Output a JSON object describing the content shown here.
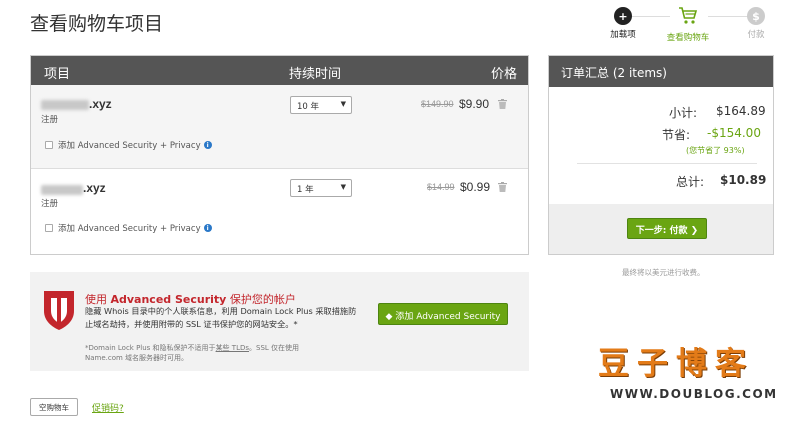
{
  "page": {
    "title": "查看购物车项目"
  },
  "steps": [
    {
      "label": "加载项",
      "glyph": "+"
    },
    {
      "label": "查看购物车"
    },
    {
      "label": "付款",
      "glyph": "$"
    }
  ],
  "cart": {
    "headers": {
      "item": "项目",
      "duration": "持续时间",
      "price": "价格"
    },
    "items": [
      {
        "domain": ".xyz",
        "type": "注册",
        "addon": "添加 Advanced Security + Privacy",
        "duration": "10 年",
        "old_price": "$149.90",
        "price": "$9.90"
      },
      {
        "domain": ".xyz",
        "type": "注册",
        "addon": "添加 Advanced Security + Privacy",
        "duration": "1 年",
        "old_price": "$14.99",
        "price": "$0.99"
      }
    ]
  },
  "summary": {
    "title": "订单汇总 (2 items)",
    "subtotal_label": "小计:",
    "subtotal": "$164.89",
    "savings_label": "节省:",
    "savings": "-$154.00",
    "savings_note": "(您节省了 93%)",
    "total_label": "总计:",
    "total": "$10.89",
    "next_button": "下一步: 付款",
    "usd_note": "最终将以美元进行收费。"
  },
  "promo": {
    "title_prefix": "使用 ",
    "title_brand": "Advanced Security",
    "title_suffix": " 保护您的帐户",
    "desc": "隐藏 Whois 目录中的个人联系信息，利用 Domain Lock Plus 采取措施防止域名劫持，并使用附带的 SSL 证书保护您的网站安全。*",
    "button": "添加 Advanced Security",
    "foot_a": "*Domain Lock Plus 和隐私保护不适用于",
    "foot_link": "某些 TLDs",
    "foot_b": "。SSL 仅在使用 Name.com 域名服务器时可用。"
  },
  "footer": {
    "empty_cart": "空购物车",
    "promo_code": "促销码?"
  },
  "watermark": {
    "chars": "豆子博客",
    "url": "WWW.DOUBLOG.COM"
  },
  "colors": {
    "accent_green": "#6aa512",
    "header_dark": "#555555",
    "promo_red": "#c3262c"
  }
}
